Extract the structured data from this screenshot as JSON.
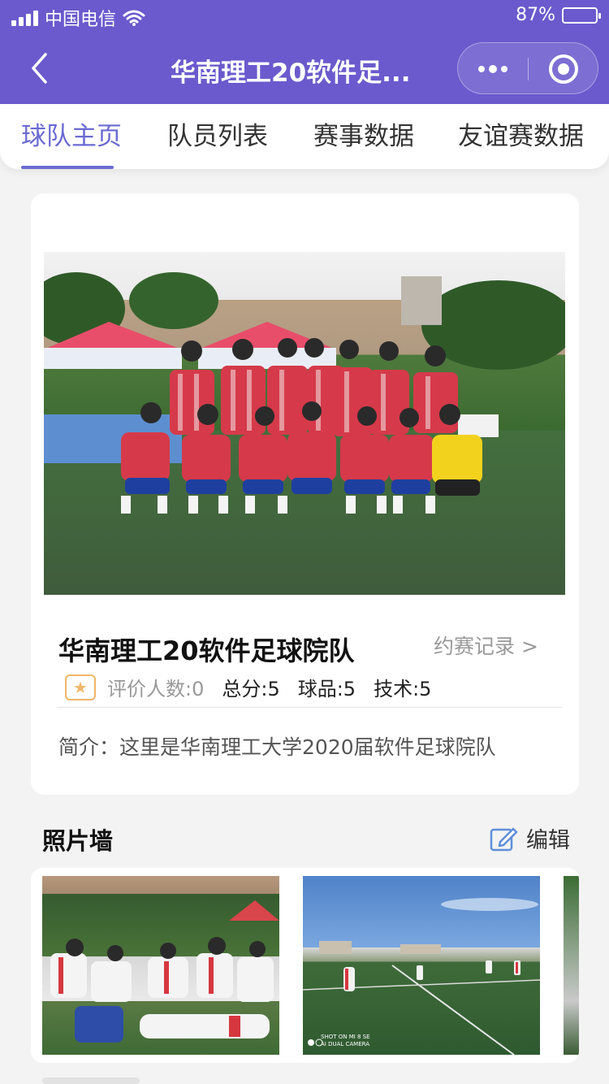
{
  "status_bar": {
    "carrier": "中国电信",
    "battery_percent": "87%",
    "battery_level": 0.87
  },
  "nav": {
    "title": "华南理工20软件足...",
    "back_icon": "chevron-left-icon",
    "more_icon": "more-dots-icon",
    "close_icon": "target-circle-icon"
  },
  "tabs": [
    {
      "label": "球队主页",
      "active": true
    },
    {
      "label": "队员列表",
      "active": false
    },
    {
      "label": "赛事数据",
      "active": false
    },
    {
      "label": "友谊赛数据",
      "active": false
    }
  ],
  "team": {
    "name": "华南理工20软件足球院队",
    "record_link": "约赛记录 >",
    "ratings": {
      "reviewers": "评价人数:0",
      "total": "总分:5",
      "sportsmanship": "球品:5",
      "skill": "技术:5"
    },
    "intro": "简介：这里是华南理工大学2020届软件足球院队"
  },
  "photo_wall": {
    "title": "照片墙",
    "edit_label": "编辑",
    "thumb_caption": "SHOT ON MI 8 SE\nAI DUAL CAMERA"
  },
  "colors": {
    "brand": "#6a5acd",
    "tab_active": "#6a6ad2",
    "star": "#f0b66a",
    "edit_icon": "#5f8fd9"
  }
}
